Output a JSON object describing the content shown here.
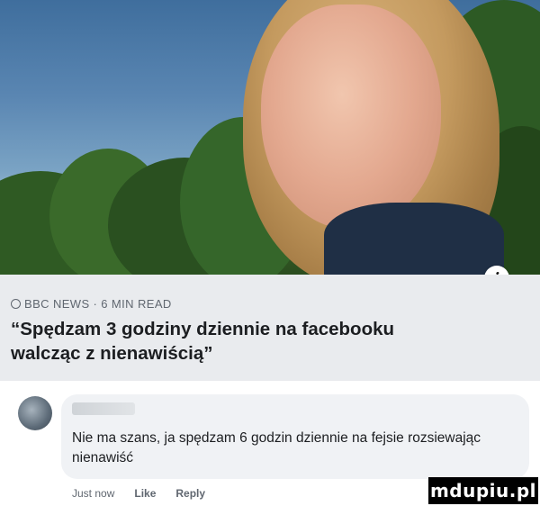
{
  "post": {
    "source": "BBC NEWS · 6 MIN READ",
    "headline": "“Spędzam 3 godziny dziennie na facebooku walcząc z nienawiścią”",
    "info_icon": "info-icon"
  },
  "comment": {
    "author": "",
    "text": "Nie ma szans, ja spędzam 6 godzin dziennie na fejsie rozsiewając nienawiść",
    "time": "Just now",
    "like_label": "Like",
    "reply_label": "Reply"
  },
  "watermark": {
    "text": "mdupiu.pl"
  },
  "colors": {
    "card_bg": "#e9ebee",
    "bubble_bg": "#f0f2f5",
    "meta_text": "#606770",
    "primary_text": "#1c1e21"
  }
}
